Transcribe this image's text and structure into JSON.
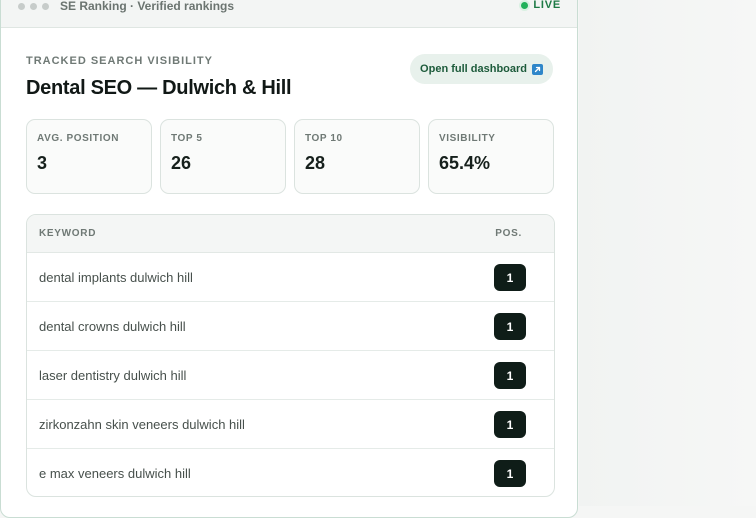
{
  "window": {
    "title": "SE Ranking · Verified rankings",
    "status": "LIVE",
    "colors": {
      "accent": "#20b15a",
      "badge": "#0f1d18",
      "border": "#c9ddd3"
    }
  },
  "header": {
    "eyebrow": "TRACKED SEARCH VISIBILITY",
    "title": "Dental SEO — Dulwich & Hill",
    "dashboard_button": "Open full dashboard",
    "dashboard_icon": "external-link-icon"
  },
  "stats": [
    {
      "label": "AVG. POSITION",
      "value": "3"
    },
    {
      "label": "TOP 5",
      "value": "26"
    },
    {
      "label": "TOP 10",
      "value": "28"
    },
    {
      "label": "VISIBILITY",
      "value": "65.4%"
    }
  ],
  "table": {
    "columns": {
      "keyword": "KEYWORD",
      "position": "POS."
    },
    "rows": [
      {
        "keyword": "dental implants dulwich hill",
        "position": "1"
      },
      {
        "keyword": "dental crowns dulwich hill",
        "position": "1"
      },
      {
        "keyword": "laser dentistry dulwich hill",
        "position": "1"
      },
      {
        "keyword": "zirkonzahn skin veneers dulwich hill",
        "position": "1"
      },
      {
        "keyword": "e max veneers dulwich hill",
        "position": "1"
      }
    ]
  }
}
